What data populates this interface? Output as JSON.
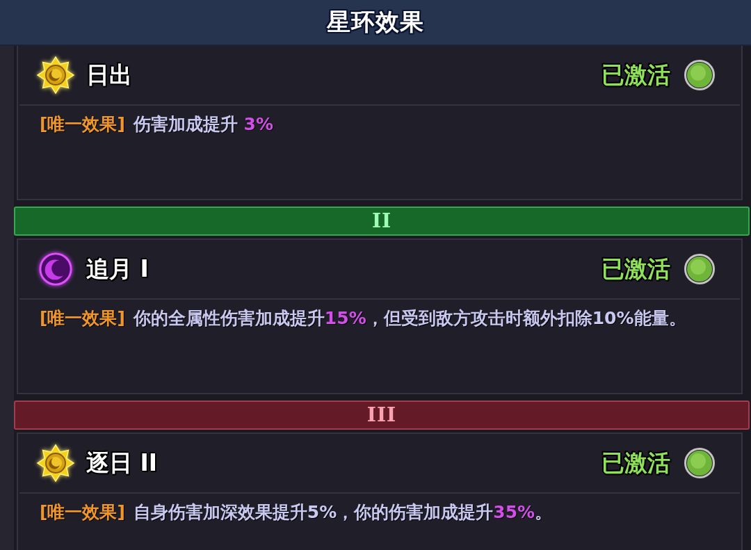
{
  "header": {
    "title": "星环效果"
  },
  "tiers": [
    {
      "effects": [
        {
          "kind": "sun",
          "name": "日出",
          "status": "已激活",
          "active": true,
          "tag": "[唯一效果]",
          "description": "伤害加成提升 **3%**"
        }
      ]
    },
    {
      "band": {
        "label": "II",
        "color": "#17692a"
      },
      "effects": [
        {
          "kind": "moon",
          "name": "追月 I",
          "status": "已激活",
          "active": true,
          "tag": "[唯一效果]",
          "description": "你的全属性伤害加成提升**15%**，但受到敌方攻击时额外扣除10%能量。"
        }
      ]
    },
    {
      "band": {
        "label": "III",
        "color": "#651b27"
      },
      "effects": [
        {
          "kind": "sun",
          "name": "逐日 II",
          "status": "已激活",
          "active": true,
          "tag": "[唯一效果]",
          "description": "自身伤害加深效果提升5%，你的伤害加成提升**35%**。"
        }
      ]
    }
  ]
}
